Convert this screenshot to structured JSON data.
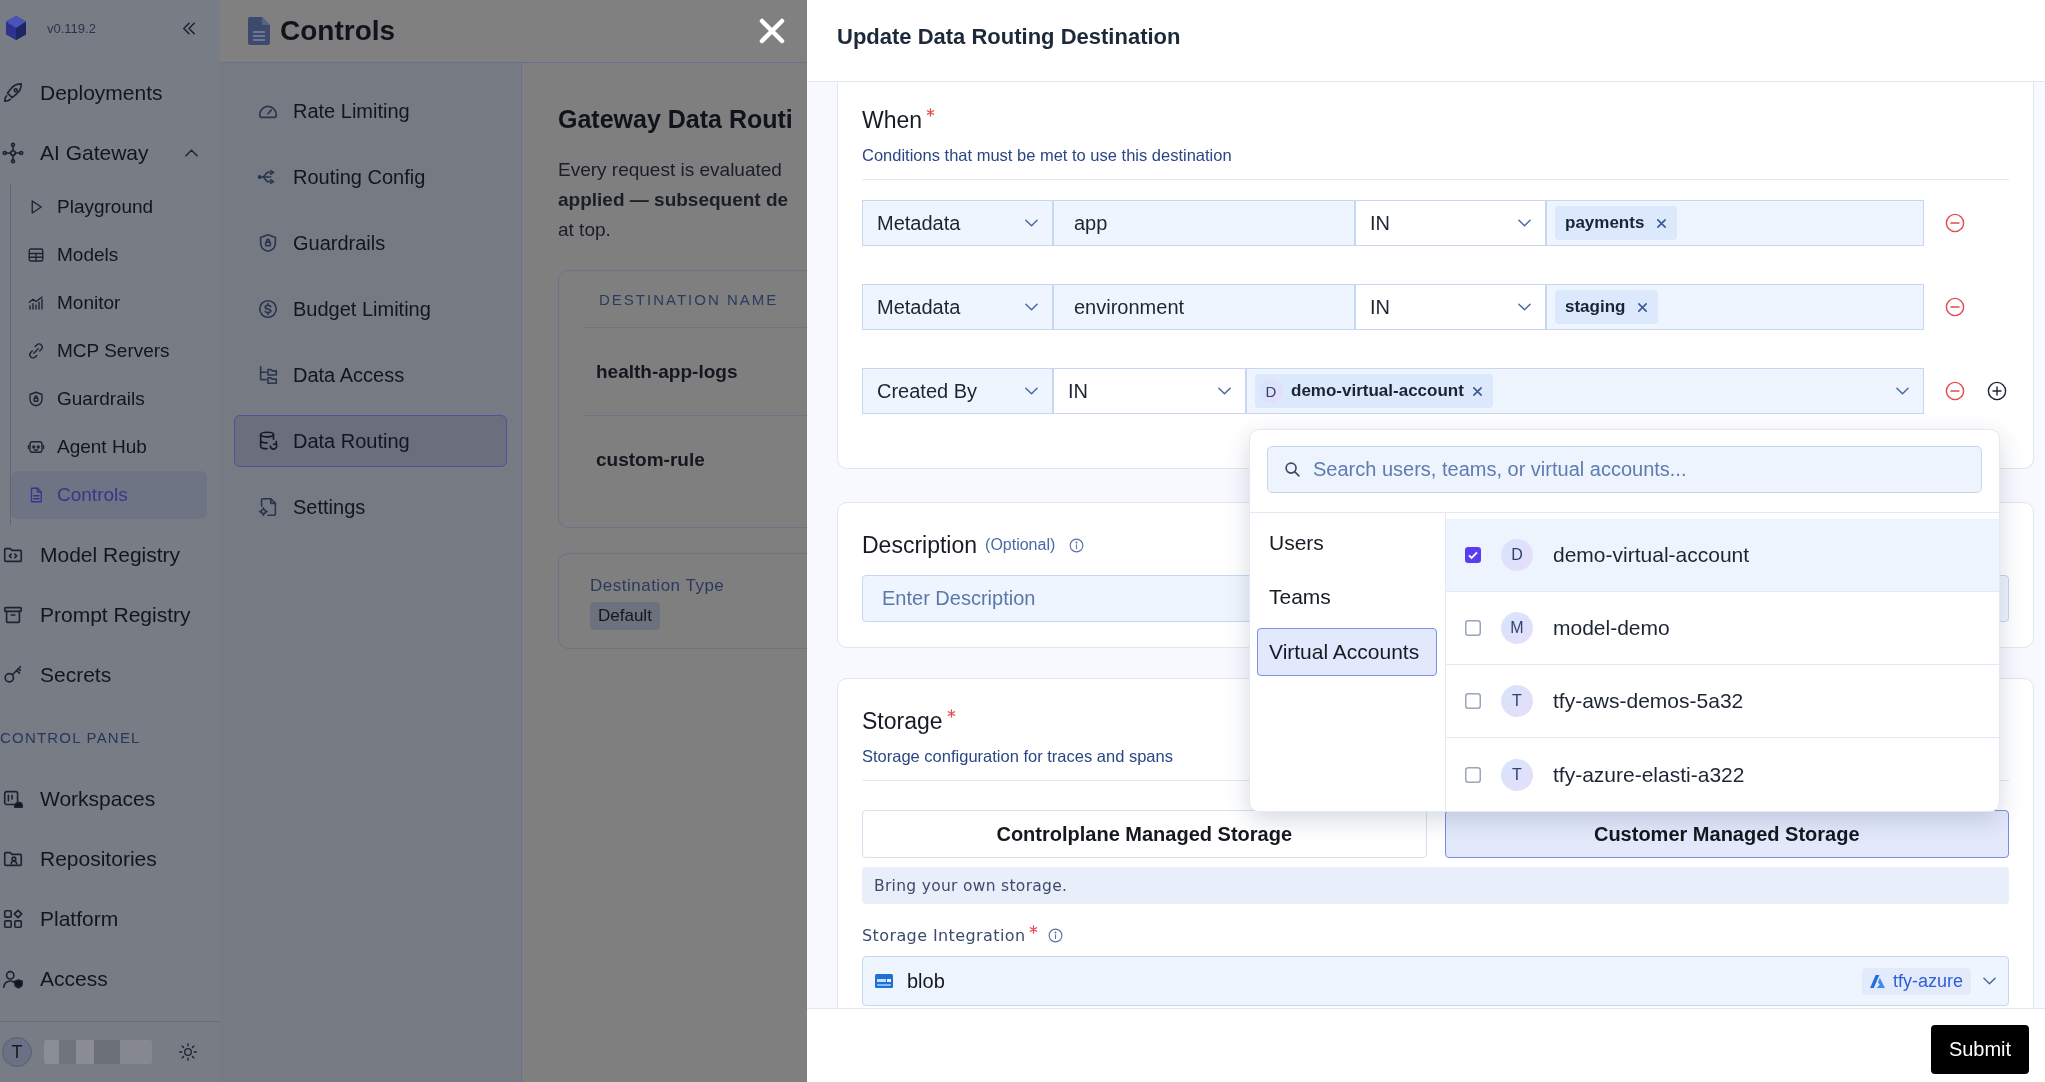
{
  "sidebar": {
    "version": "v0.119.2",
    "items": [
      {
        "label": "Deployments",
        "selected": false
      },
      {
        "label": "AI Gateway",
        "selected": false,
        "expanded": true,
        "children": [
          {
            "label": "Playground",
            "selected": false
          },
          {
            "label": "Models",
            "selected": false
          },
          {
            "label": "Monitor",
            "selected": false
          },
          {
            "label": "MCP Servers",
            "selected": false
          },
          {
            "label": "Guardrails",
            "selected": false
          },
          {
            "label": "Agent Hub",
            "selected": false
          },
          {
            "label": "Controls",
            "selected": true
          }
        ]
      },
      {
        "label": "Model Registry",
        "selected": false
      },
      {
        "label": "Prompt Registry",
        "selected": false
      },
      {
        "label": "Secrets",
        "selected": false
      }
    ],
    "section": {
      "title": "CONTROL PANEL",
      "items": [
        {
          "label": "Workspaces",
          "selected": false
        },
        {
          "label": "Repositories",
          "selected": false
        },
        {
          "label": "Platform",
          "selected": false
        },
        {
          "label": "Access",
          "selected": false
        }
      ]
    },
    "user": {
      "initial": "T"
    }
  },
  "controls_panel": {
    "title": "Controls",
    "nav": [
      {
        "label": "Rate Limiting",
        "selected": false
      },
      {
        "label": "Routing Config",
        "selected": false
      },
      {
        "label": "Guardrails",
        "selected": false
      },
      {
        "label": "Budget Limiting",
        "selected": false
      },
      {
        "label": "Data Access",
        "selected": false
      },
      {
        "label": "Data Routing",
        "selected": true
      },
      {
        "label": "Settings",
        "selected": false
      }
    ],
    "page": {
      "title": "Gateway Data Routi",
      "description": "Every request is evaluated\n**applied — subsequent de**\nat top.",
      "table": {
        "columns": [
          "DESTINATION NAME"
        ],
        "rows": [
          [
            "health-app-logs"
          ],
          [
            "custom-rule"
          ]
        ]
      },
      "destination_type": {
        "label": "Destination Type",
        "value": "Default"
      }
    }
  },
  "dialog": {
    "title": "Update Data Routing Destination",
    "when": {
      "title": "When",
      "required": true,
      "subtitle": "Conditions that must be met to use this destination",
      "conditions": [
        {
          "kind": "metadata",
          "field": "Metadata",
          "key": "app",
          "operator": "IN",
          "values": [
            "payments"
          ]
        },
        {
          "kind": "metadata",
          "field": "Metadata",
          "key": "environment",
          "operator": "IN",
          "values": [
            "staging"
          ]
        },
        {
          "kind": "subject",
          "field": "Created By",
          "operator": "IN",
          "values": [
            {
              "initial": "D",
              "label": "demo-virtual-account"
            }
          ],
          "dropdown": {
            "placeholder": "Search users, teams, or virtual accounts...",
            "categories": [
              {
                "label": "Users",
                "selected": false
              },
              {
                "label": "Teams",
                "selected": false
              },
              {
                "label": "Virtual Accounts",
                "selected": true
              }
            ],
            "options": [
              {
                "initial": "D",
                "label": "demo-virtual-account",
                "checked": true
              },
              {
                "initial": "M",
                "label": "model-demo",
                "checked": false
              },
              {
                "initial": "T",
                "label": "tfy-aws-demos-5a32",
                "checked": false
              },
              {
                "initial": "T",
                "label": "tfy-azure-elasti-a322",
                "checked": false
              }
            ]
          }
        }
      ]
    },
    "description": {
      "title": "Description",
      "optional": "(Optional)",
      "placeholder": "Enter Description"
    },
    "storage": {
      "title": "Storage",
      "required": true,
      "subtitle": "Storage configuration for traces and spans",
      "options": [
        {
          "label": "Controlplane Managed Storage",
          "selected": false
        },
        {
          "label": "Customer Managed Storage",
          "selected": true
        }
      ],
      "note": "Bring your own storage.",
      "integration": {
        "label": "Storage Integration",
        "required": true,
        "value": "blob",
        "provider": "tfy-azure"
      }
    },
    "submit": "Submit"
  }
}
